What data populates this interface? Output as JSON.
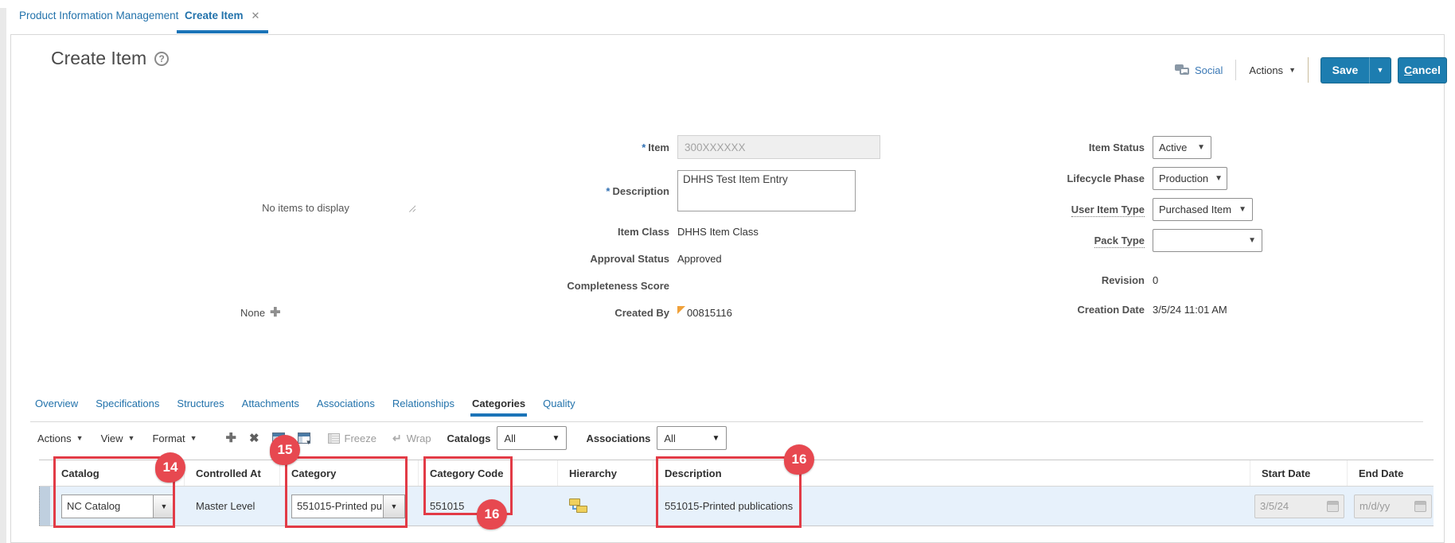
{
  "window_tabs": {
    "primary": "Product Information Management",
    "active": "Create Item"
  },
  "header": {
    "title": "Create Item",
    "social_label": "Social",
    "actions_label": "Actions",
    "save_label": "Save",
    "cancel_initial": "C",
    "cancel_rest": "ancel"
  },
  "left_panel": {
    "empty_text": "No items to display",
    "attachments_label": "None"
  },
  "form": {
    "item": {
      "label": "Item",
      "value": "300XXXXXX"
    },
    "description": {
      "label": "Description",
      "value": "DHHS Test Item Entry"
    },
    "item_class": {
      "label": "Item Class",
      "value": "DHHS Item Class"
    },
    "approval_status": {
      "label": "Approval Status",
      "value": "Approved"
    },
    "completeness_score": {
      "label": "Completeness Score",
      "value": ""
    },
    "created_by": {
      "label": "Created By",
      "value": "00815116"
    },
    "item_status": {
      "label": "Item Status",
      "value": "Active"
    },
    "lifecycle_phase": {
      "label": "Lifecycle Phase",
      "value": "Production"
    },
    "user_item_type": {
      "label": "User Item Type",
      "value": "Purchased Item"
    },
    "pack_type": {
      "label": "Pack Type",
      "value": ""
    },
    "revision": {
      "label": "Revision",
      "value": "0"
    },
    "creation_date": {
      "label": "Creation Date",
      "value": "3/5/24 11:01 AM"
    }
  },
  "subtabs": {
    "items": [
      {
        "label": "Overview"
      },
      {
        "label": "Specifications"
      },
      {
        "label": "Structures"
      },
      {
        "label": "Attachments"
      },
      {
        "label": "Associations"
      },
      {
        "label": "Relationships"
      },
      {
        "label": "Categories"
      },
      {
        "label": "Quality"
      }
    ],
    "active": "Categories"
  },
  "toolbar": {
    "actions_label": "Actions",
    "view_label": "View",
    "format_label": "Format",
    "freeze_label": "Freeze",
    "wrap_label": "Wrap",
    "catalogs_label": "Catalogs",
    "catalogs_value": "All",
    "associations_label": "Associations",
    "associations_value": "All"
  },
  "table": {
    "columns": [
      "Catalog",
      "Controlled At",
      "Category",
      "Category Code",
      "Hierarchy",
      "Description",
      "Start Date",
      "End Date"
    ],
    "row": {
      "catalog": "NC Catalog",
      "controlled_at": "Master Level",
      "category": "551015-Printed pu",
      "category_code": "551015",
      "description": "551015-Printed publications",
      "start_date": "3/5/24",
      "end_date_placeholder": "m/d/yy"
    }
  },
  "annotations": {
    "b14": "14",
    "b15": "15",
    "b16": "16"
  },
  "icons": {
    "caret_down": "▼",
    "help": "?",
    "required": "*",
    "plus": "✚",
    "close_x": "✖",
    "tab_close": "✕",
    "wrap_arrow": "↵"
  },
  "colors": {
    "accent_blue": "#1b74b8",
    "link_blue": "#2272ab",
    "button_blue": "#1d7db0",
    "annotation_red": "#e23b46",
    "badge_red": "#e74850",
    "row_selected": "#e7f1fb",
    "disabled_bg": "#efefef",
    "orange_flag": "#f0a13a"
  }
}
